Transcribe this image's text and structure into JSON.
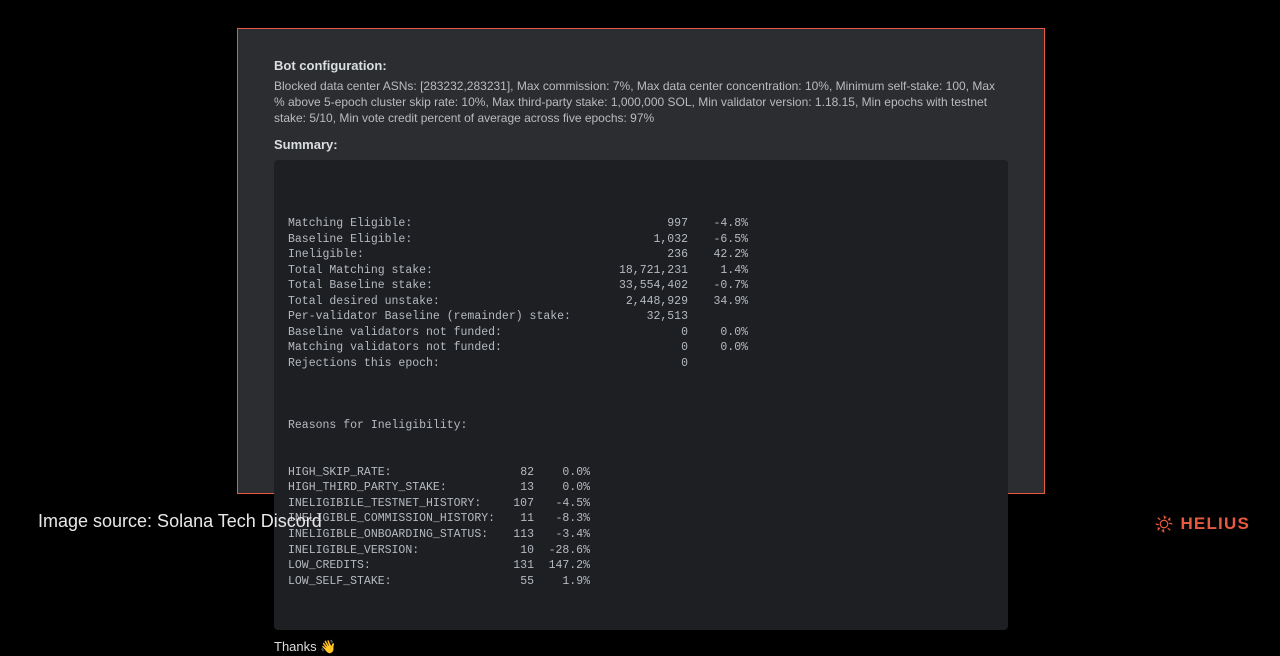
{
  "config": {
    "heading": "Bot configuration:",
    "text": "Blocked data center ASNs: [283232,283231], Max commission: 7%, Max data center concentration: 10%, Minimum self-stake: 100, Max % above 5-epoch cluster skip rate: 10%, Max third-party stake: 1,000,000 SOL, Min validator version: 1.18.15, Min epochs with testnet stake: 5/10, Min vote credit percent of average across five epochs: 97%"
  },
  "summary": {
    "heading": "Summary:",
    "rows": [
      {
        "label": "Matching Eligible:",
        "count": "997",
        "pct": "-4.8%"
      },
      {
        "label": "Baseline Eligible:",
        "count": "1,032",
        "pct": "-6.5%"
      },
      {
        "label": "Ineligible:",
        "count": "236",
        "pct": "42.2%"
      },
      {
        "label": "Total Matching stake:",
        "count": "18,721,231",
        "pct": "1.4%"
      },
      {
        "label": "Total Baseline stake:",
        "count": "33,554,402",
        "pct": "-0.7%"
      },
      {
        "label": "Total desired unstake:",
        "count": "2,448,929",
        "pct": "34.9%"
      },
      {
        "label": "Per-validator Baseline (remainder) stake:",
        "count": "32,513",
        "pct": ""
      },
      {
        "label": "Baseline validators not funded:",
        "count": "0",
        "pct": "0.0%"
      },
      {
        "label": "Matching validators not funded:",
        "count": "0",
        "pct": "0.0%"
      },
      {
        "label": "Rejections this epoch:",
        "count": "0",
        "pct": ""
      }
    ]
  },
  "ineligibility": {
    "heading": "Reasons for Ineligibility:",
    "rows": [
      {
        "label": "HIGH_SKIP_RATE:",
        "count": "82",
        "pct": "0.0%"
      },
      {
        "label": "HIGH_THIRD_PARTY_STAKE:",
        "count": "13",
        "pct": "0.0%"
      },
      {
        "label": "INELIGIBILE_TESTNET_HISTORY:",
        "count": "107",
        "pct": "-4.5%"
      },
      {
        "label": "INELIGIBLE_COMMISSION_HISTORY:",
        "count": "11",
        "pct": "-8.3%"
      },
      {
        "label": "INELIGIBLE_ONBOARDING_STATUS:",
        "count": "113",
        "pct": "-3.4%"
      },
      {
        "label": "INELIGIBLE_VERSION:",
        "count": "10",
        "pct": "-28.6%"
      },
      {
        "label": "LOW_CREDITS:",
        "count": "131",
        "pct": "147.2%"
      },
      {
        "label": "LOW_SELF_STAKE:",
        "count": "55",
        "pct": "1.9%"
      }
    ]
  },
  "thanks": "Thanks 👋",
  "caption": "Image source: Solana Tech Discord",
  "brand": "HELIUS"
}
